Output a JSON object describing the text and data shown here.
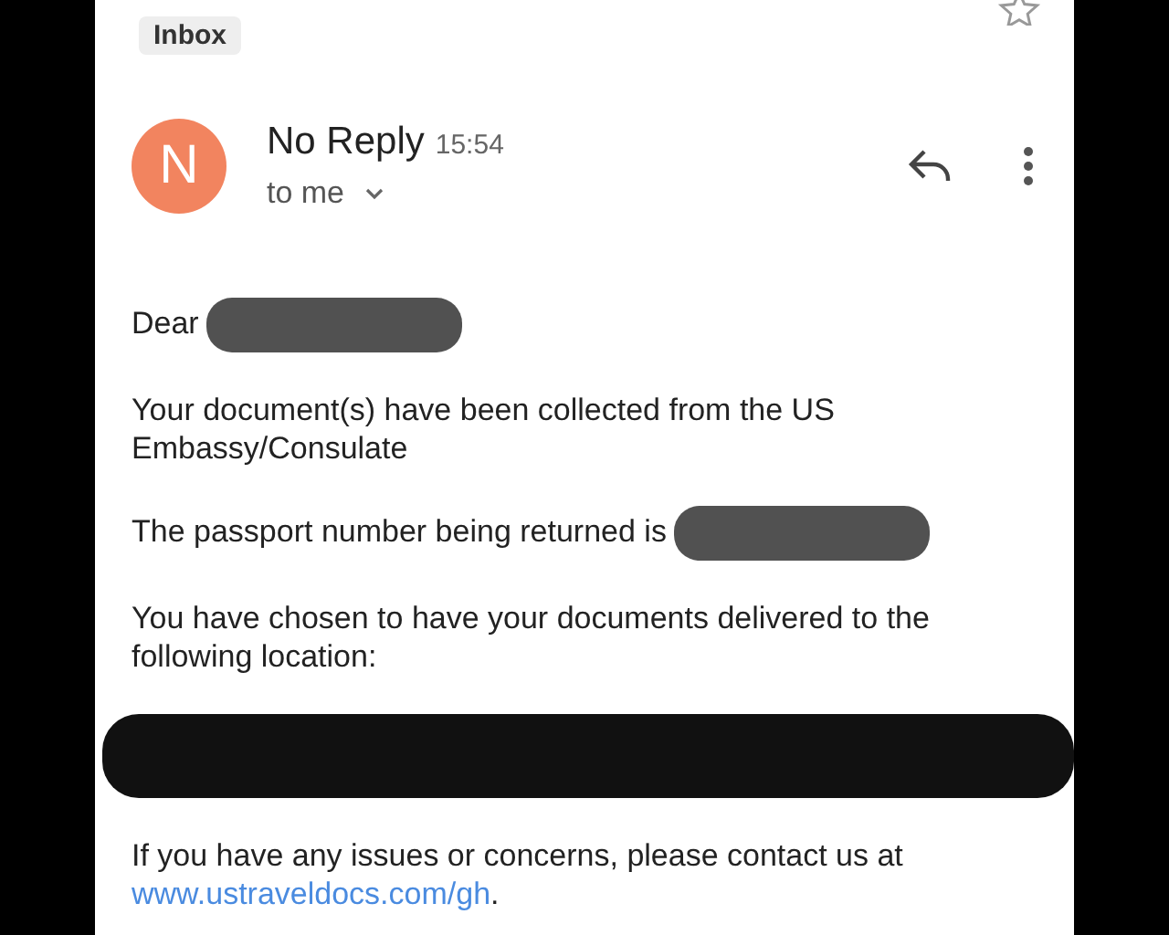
{
  "label": "Inbox",
  "message": {
    "avatar": "N",
    "sender": "No Reply",
    "time": "15:54",
    "recipient": "to me"
  },
  "body": [
    {
      "kind": "text",
      "text": "Dear",
      "redacted": true
    },
    {
      "kind": "text",
      "text": "Your document(s) have been collected from the US Embassy/Consulate",
      "redacted": false
    },
    {
      "kind": "text",
      "text": "The passport number being returned is",
      "redacted": true
    },
    {
      "kind": "text",
      "text": "You have chosen to have your documents delivered to the following location:",
      "redacted": false
    },
    {
      "kind": "redaction"
    },
    {
      "kind": "link",
      "text": "If you have any issues or concerns, please contact us at",
      "link": "www.ustraveldocs.com/gh",
      "after": "."
    }
  ]
}
